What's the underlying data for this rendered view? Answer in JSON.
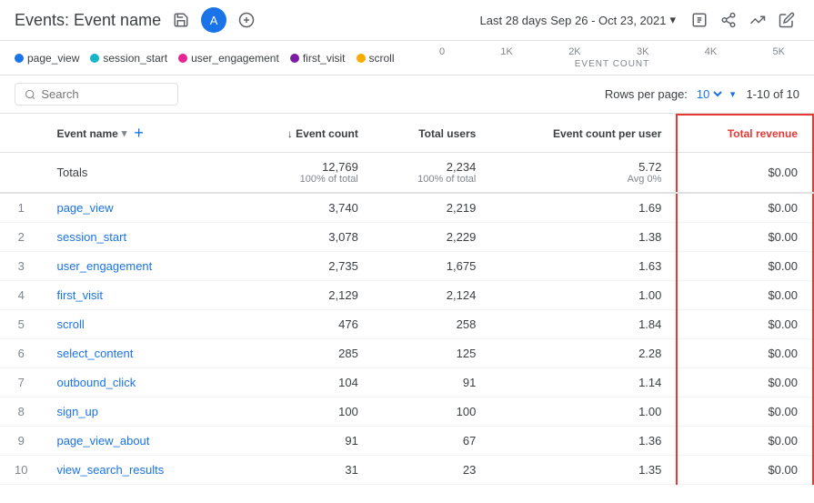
{
  "header": {
    "title": "Events: Event name",
    "avatar": "A",
    "date_label": "Last 28 days",
    "date_range": "Sep 26 - Oct 23, 2021",
    "save_icon": "💾",
    "share_icon": "↗",
    "trend_icon": "〰",
    "edit_icon": "✏"
  },
  "legend": {
    "items": [
      {
        "label": "page_view",
        "color": "#1a73e8"
      },
      {
        "label": "session_start",
        "color": "#12b5cb"
      },
      {
        "label": "user_engagement",
        "color": "#e52592"
      },
      {
        "label": "first_visit",
        "color": "#7b1fa2"
      },
      {
        "label": "scroll",
        "color": "#f9ab00"
      }
    ]
  },
  "x_axis": {
    "labels": [
      "0",
      "1K",
      "2K",
      "3K",
      "4K",
      "5K"
    ],
    "event_count_label": "EVENT COUNT"
  },
  "search": {
    "placeholder": "Search"
  },
  "table_controls": {
    "rows_per_page_label": "Rows per page:",
    "rows_per_page_value": "10",
    "pagination": "1-10 of 10"
  },
  "columns": {
    "event_name": "Event name",
    "event_count": "↓ Event count",
    "total_users": "Total users",
    "event_count_per_user": "Event count per user",
    "total_revenue": "Total revenue"
  },
  "totals": {
    "label": "Totals",
    "event_count": "12,769",
    "event_count_sub": "100% of total",
    "total_users": "2,234",
    "total_users_sub": "100% of total",
    "event_count_per_user": "5.72",
    "event_count_per_user_sub": "Avg 0%",
    "total_revenue": "$0.00"
  },
  "rows": [
    {
      "index": 1,
      "name": "page_view",
      "event_count": "3,740",
      "total_users": "2,219",
      "epu": "1.69",
      "revenue": "$0.00"
    },
    {
      "index": 2,
      "name": "session_start",
      "event_count": "3,078",
      "total_users": "2,229",
      "epu": "1.38",
      "revenue": "$0.00"
    },
    {
      "index": 3,
      "name": "user_engagement",
      "event_count": "2,735",
      "total_users": "1,675",
      "epu": "1.63",
      "revenue": "$0.00"
    },
    {
      "index": 4,
      "name": "first_visit",
      "event_count": "2,129",
      "total_users": "2,124",
      "epu": "1.00",
      "revenue": "$0.00"
    },
    {
      "index": 5,
      "name": "scroll",
      "event_count": "476",
      "total_users": "258",
      "epu": "1.84",
      "revenue": "$0.00"
    },
    {
      "index": 6,
      "name": "select_content",
      "event_count": "285",
      "total_users": "125",
      "epu": "2.28",
      "revenue": "$0.00"
    },
    {
      "index": 7,
      "name": "outbound_click",
      "event_count": "104",
      "total_users": "91",
      "epu": "1.14",
      "revenue": "$0.00"
    },
    {
      "index": 8,
      "name": "sign_up",
      "event_count": "100",
      "total_users": "100",
      "epu": "1.00",
      "revenue": "$0.00"
    },
    {
      "index": 9,
      "name": "page_view_about",
      "event_count": "91",
      "total_users": "67",
      "epu": "1.36",
      "revenue": "$0.00"
    },
    {
      "index": 10,
      "name": "view_search_results",
      "event_count": "31",
      "total_users": "23",
      "epu": "1.35",
      "revenue": "$0.00"
    }
  ]
}
